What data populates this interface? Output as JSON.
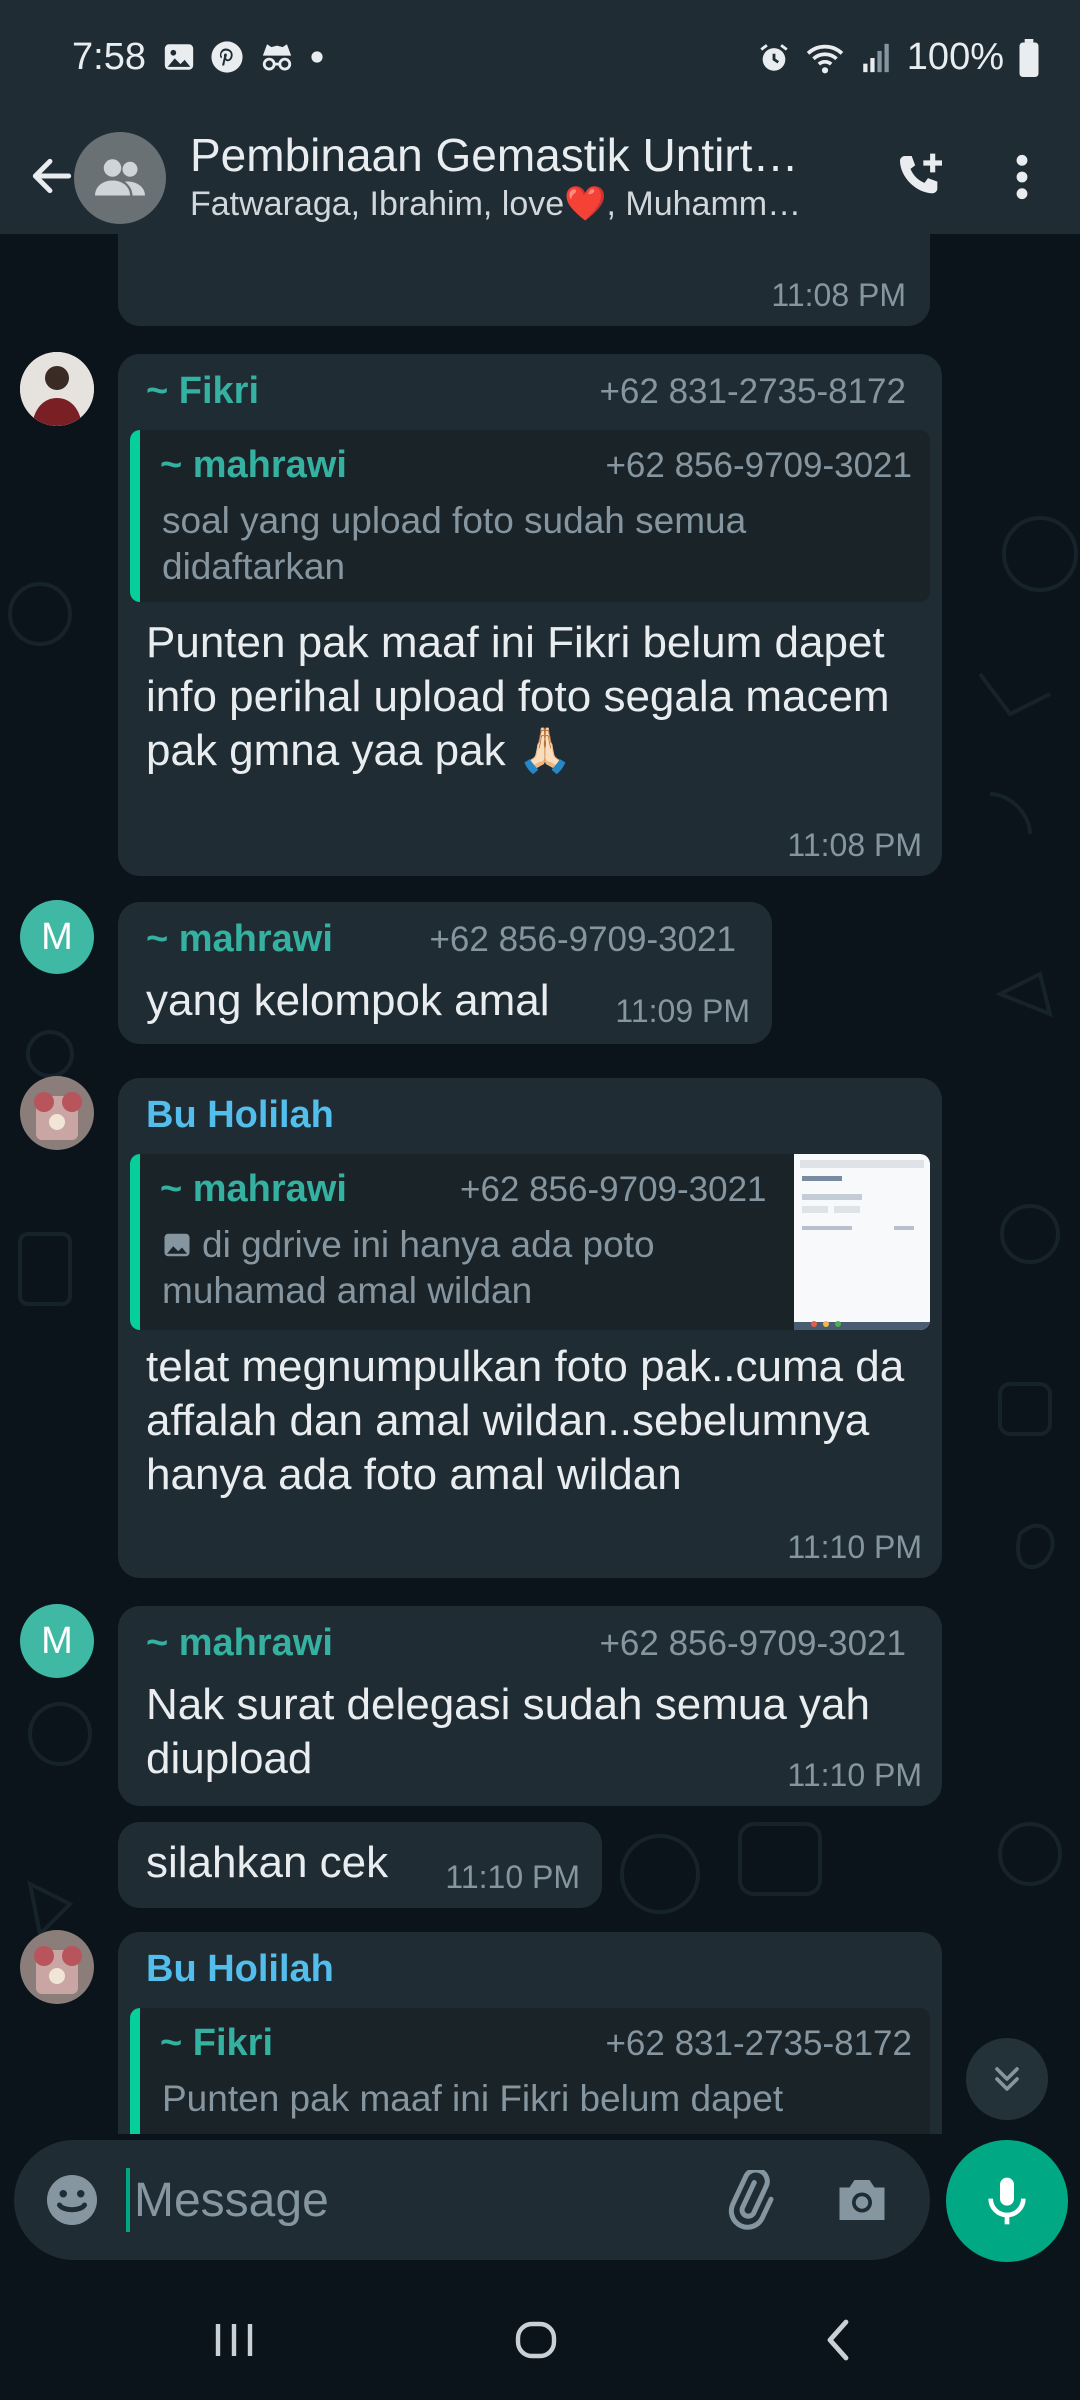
{
  "status_bar": {
    "time": "7:58",
    "battery": "100%"
  },
  "header": {
    "title": "Pembinaan Gemastik Untirt…",
    "subtitle": "Fatwaraga, Ibrahim, love❤️, Muhamm…"
  },
  "messages": [
    {
      "time": "11:08 PM"
    },
    {
      "sender": "~ Fikri",
      "phone": "+62 831-2735-8172",
      "quote": {
        "sender": "~ mahrawi",
        "phone": "+62 856-9709-3021",
        "text": "soal yang upload foto sudah semua didaftarkan"
      },
      "text": "Punten pak maaf ini Fikri belum dapet info perihal upload foto segala macem pak gmna yaa pak 🙏🏻",
      "time": "11:08 PM"
    },
    {
      "avatar_letter": "M",
      "sender": "~ mahrawi",
      "phone": "+62 856-9709-3021",
      "text": "yang kelompok amal",
      "time": "11:09 PM"
    },
    {
      "sender": "Bu Holilah",
      "quote": {
        "sender": "~ mahrawi",
        "phone": "+62 856-9709-3021",
        "text": "di gdrive ini hanya ada poto muhamad amal wildan"
      },
      "text": "telat megnumpulkan foto pak..cuma da affalah dan amal wildan..sebelumnya hanya ada foto amal wildan",
      "time": "11:10 PM"
    },
    {
      "avatar_letter": "M",
      "sender": "~ mahrawi",
      "phone": "+62 856-9709-3021",
      "text": "Nak surat delegasi sudah semua yah diupload",
      "time": "11:10 PM"
    },
    {
      "text": "silahkan cek",
      "time": "11:10 PM"
    },
    {
      "sender": "Bu Holilah",
      "quote": {
        "sender": "~ Fikri",
        "phone": "+62 831-2735-8172",
        "text": "Punten pak maaf ini Fikri belum dapet"
      }
    }
  ],
  "composer": {
    "placeholder": "Message"
  },
  "colors": {
    "accent": "#00a884",
    "bubble": "#202c33",
    "background": "#0b141a",
    "sender_teal": "#35b1a1",
    "sender_blue": "#53bdeb"
  },
  "icons": [
    "gallery-icon",
    "pinterest-icon",
    "incognito-icon",
    "alarm-icon",
    "wifi-icon",
    "signal-icon",
    "battery-icon",
    "back-arrow-icon",
    "group-avatar-icon",
    "add-call-icon",
    "more-vert-icon",
    "emoji-icon",
    "attach-icon",
    "camera-icon",
    "mic-icon",
    "chevron-double-down-icon",
    "recents-icon",
    "home-icon",
    "nav-back-icon"
  ]
}
